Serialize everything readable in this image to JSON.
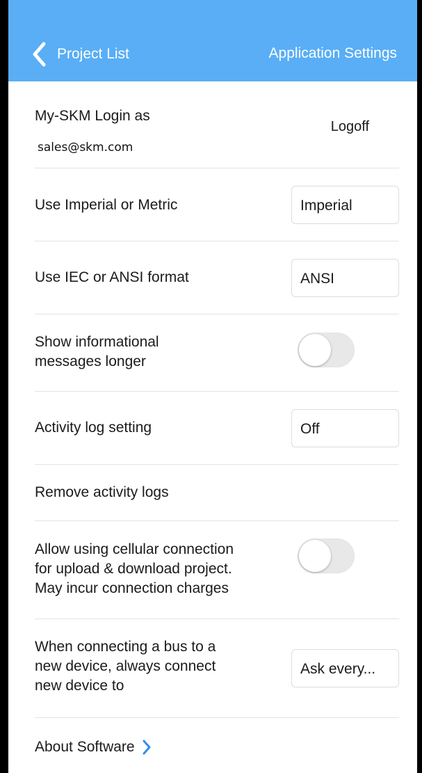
{
  "header": {
    "back_label": "Project List",
    "title": "Application Settings",
    "color": "#59aef5"
  },
  "login": {
    "label": "My-SKM Login as",
    "email": "sales@skm.com",
    "logoff_label": "Logoff"
  },
  "settings": [
    {
      "label": "Use Imperial or Metric",
      "value": "Imperial"
    },
    {
      "label": "Use IEC or ANSI format",
      "value": "ANSI"
    },
    {
      "label_lines": [
        "Show informational",
        "messages longer"
      ],
      "toggle_on": false
    },
    {
      "label": "Activity log setting",
      "value": "Off"
    },
    {
      "label": "Remove activity logs"
    },
    {
      "label_lines": [
        "Allow using cellular connection",
        "for upload & download project.",
        "May incur connection charges"
      ],
      "toggle_on": false
    },
    {
      "label_lines": [
        "When connecting a bus to a",
        "new device, always connect",
        "new device to"
      ],
      "value": "Ask every..."
    }
  ],
  "about": {
    "label": "About Software",
    "icon": "chevron-right-icon",
    "chevron_color": "#2f8ef0"
  }
}
